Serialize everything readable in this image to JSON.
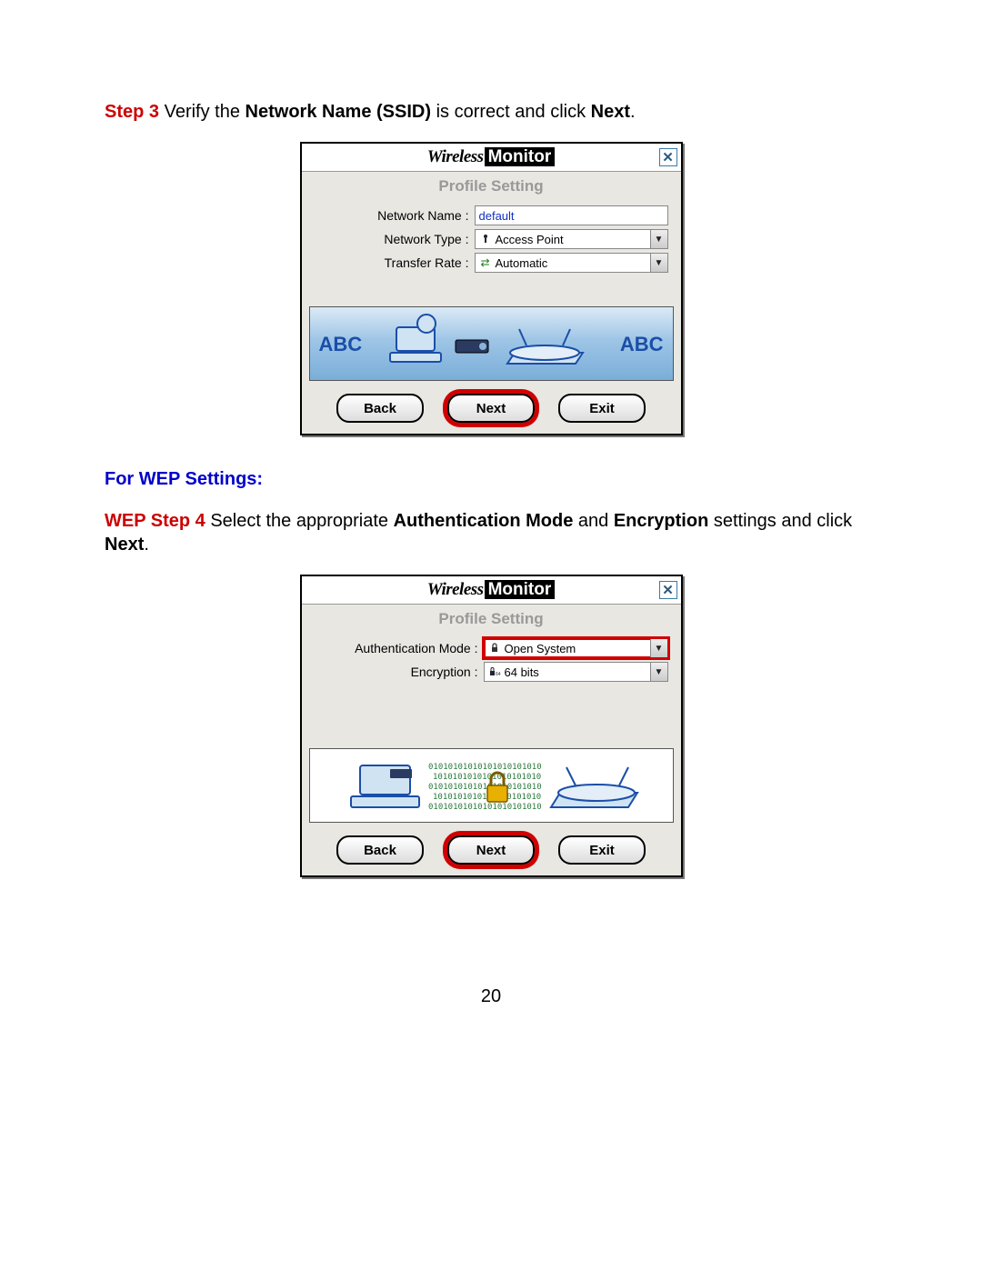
{
  "step3": {
    "label": "Step 3",
    "text_prefix": " Verify the ",
    "bold1": "Network Name (SSID)",
    "text_mid": " is correct and click ",
    "bold2": "Next",
    "text_suffix": "."
  },
  "dialog1": {
    "title_wireless": "Wireless",
    "title_monitor": "Monitor",
    "subtitle": "Profile Setting",
    "fields": {
      "network_name_label": "Network Name :",
      "network_name_value": "default",
      "network_type_label": "Network Type :",
      "network_type_value": "Access Point",
      "transfer_rate_label": "Transfer Rate :",
      "transfer_rate_value": "Automatic"
    },
    "banner": {
      "abc_left": "ABC",
      "abc_right": "ABC"
    },
    "buttons": {
      "back": "Back",
      "next": "Next",
      "exit": "Exit"
    }
  },
  "wep_heading": "For WEP Settings:",
  "step4": {
    "label": "WEP Step 4",
    "text_prefix": " Select the appropriate ",
    "bold1": "Authentication Mode",
    "text_mid1": " and ",
    "bold2": "Encryption",
    "text_mid2": " settings and click ",
    "bold3": "Next",
    "text_suffix": "."
  },
  "dialog2": {
    "title_wireless": "Wireless",
    "title_monitor": "Monitor",
    "subtitle": "Profile Setting",
    "fields": {
      "auth_mode_label": "Authentication Mode :",
      "auth_mode_value": "Open System",
      "encryption_label": "Encryption :",
      "encryption_value": "64 bits"
    },
    "buttons": {
      "back": "Back",
      "next": "Next",
      "exit": "Exit"
    }
  },
  "page_number": "20"
}
